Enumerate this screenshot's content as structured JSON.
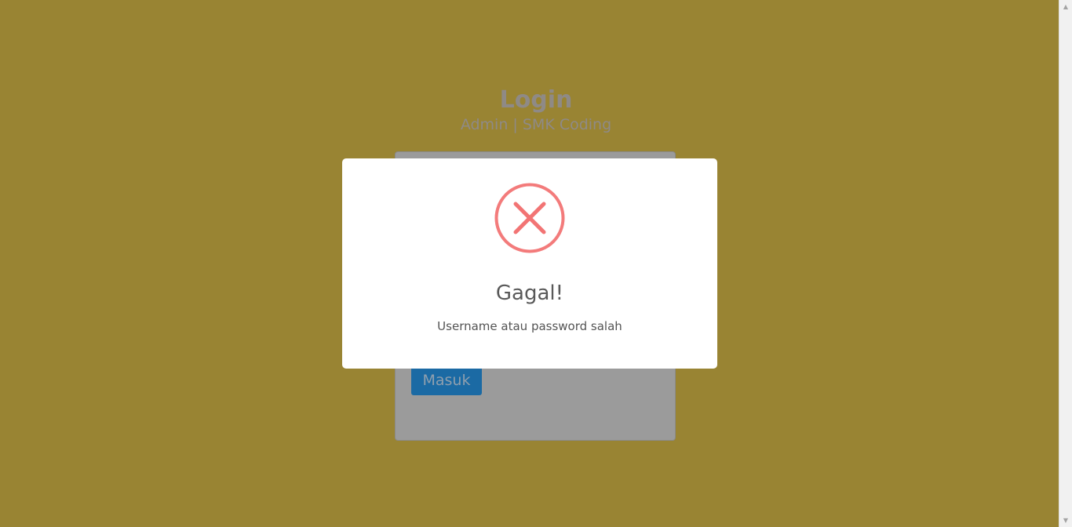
{
  "login": {
    "title": "Login",
    "subtitle": "Admin | SMK Coding",
    "submit_label": "Masuk"
  },
  "alert": {
    "icon": "error-x-icon",
    "title": "Gagal!",
    "message": "Username atau password salah"
  },
  "colors": {
    "page_background": "#998433",
    "modal_background": "#ffffff",
    "error_icon": "#f27474",
    "button": "#1b6aa4"
  },
  "scrollbar": {
    "up_icon": "scroll-up-arrow-icon",
    "down_icon": "scroll-down-arrow-icon"
  }
}
